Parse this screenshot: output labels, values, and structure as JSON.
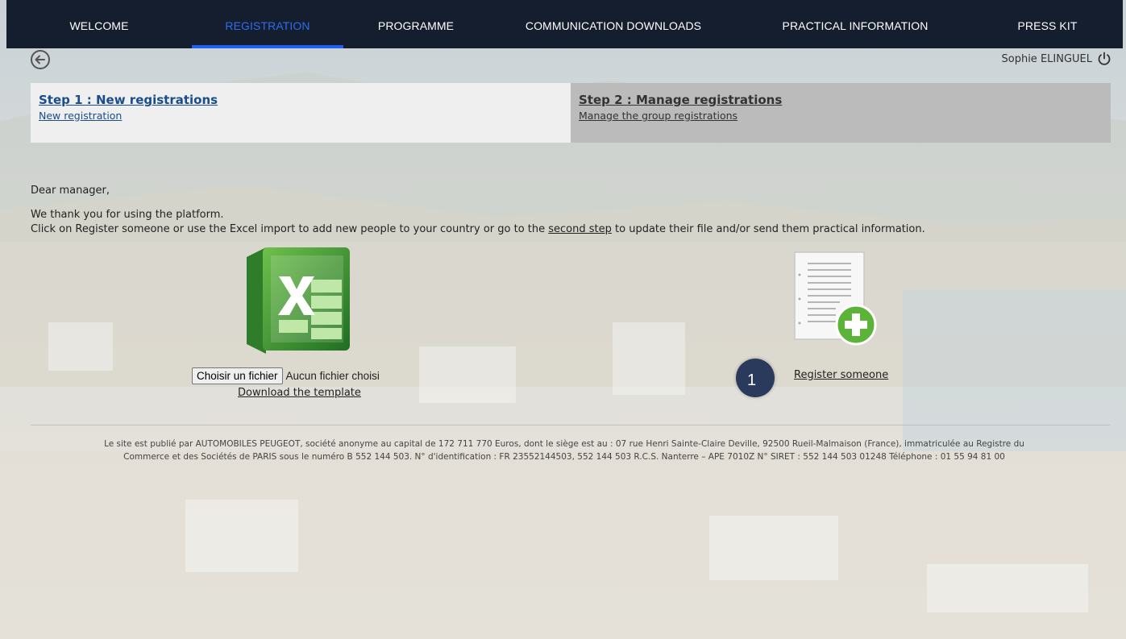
{
  "nav": {
    "items": [
      {
        "label": "WELCOME",
        "active": false
      },
      {
        "label": "REGISTRATION",
        "active": true
      },
      {
        "label": "PROGRAMME",
        "active": false
      },
      {
        "label": "COMMUNICATION DOWNLOADS",
        "active": false
      },
      {
        "label": "PRACTICAL INFORMATION",
        "active": false
      },
      {
        "label": "PRESS KIT",
        "active": false
      }
    ],
    "active_color": "#2f6cf2",
    "background": "#141e2e"
  },
  "header": {
    "back_icon": "arrow-left-circle-icon",
    "user_name": "Sophie ELINGUEL",
    "logout_icon": "power-icon"
  },
  "steps": [
    {
      "title": "Step 1 : New registrations",
      "link": "New registration"
    },
    {
      "title": "Step 2 : Manage registrations",
      "link": "Manage the group registrations"
    }
  ],
  "intro": {
    "greeting": "Dear manager,",
    "line1": "We thank you for using the platform.",
    "line2_before": "Click on Register someone or use the Excel import to add new people to your country or go to the ",
    "line2_link": "second step",
    "line2_after": " to update their file and/or send them practical information."
  },
  "excel_import": {
    "icon": "excel-icon",
    "file_button": "Choisir un fichier",
    "file_status": "Aucun fichier choisi",
    "download_link": "Download the template"
  },
  "register": {
    "icon": "add-document-icon",
    "badge": "1",
    "link": "Register someone"
  },
  "footer": {
    "line1": "Le site est publié par AUTOMOBILES PEUGEOT, société anonyme au capital de 172 711 770 Euros, dont le siège est au : 07 rue Henri Sainte-Claire Deville, 92500 Rueil-Malmaison (France), immatriculée au Registre du",
    "line2": "Commerce et des Sociétés de PARIS sous le numéro B 552 144 503. N° d'identification : FR 23552144503, 552 144 503 R.C.S. Nanterre – APE 7010Z N° SIRET : 552 144 503 01248 Téléphone : 01 55 94 81 00"
  }
}
